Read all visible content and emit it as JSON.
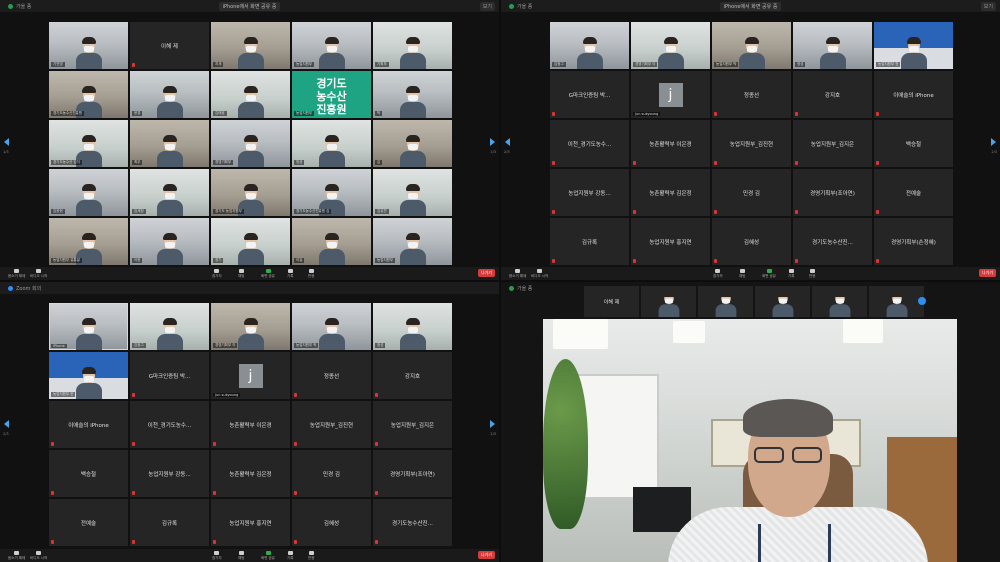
{
  "screen_tl": {
    "title_left": "가을 종",
    "title_center": "iPhone에서 화면 공유 중",
    "title_right": "보기",
    "page_left": "1/3",
    "page_right": "1/3",
    "tiles": [
      {
        "type": "video",
        "label": "기연영"
      },
      {
        "type": "name",
        "name": "이해 제"
      },
      {
        "type": "video",
        "label": "지세"
      },
      {
        "type": "video",
        "label": "농업지원부"
      },
      {
        "type": "video",
        "label": "기획부"
      },
      {
        "type": "video",
        "label": "경기도농수산진흥원"
      },
      {
        "type": "video",
        "label": "윤경"
      },
      {
        "type": "video",
        "label": "김태호"
      },
      {
        "type": "logo",
        "logo_text": "경기도\n농수산\n진흥원",
        "label": "농업지원부"
      },
      {
        "type": "video",
        "label": "박"
      },
      {
        "type": "video",
        "label": "경기도농수산 김이"
      },
      {
        "type": "video",
        "label": "최우"
      },
      {
        "type": "video",
        "label": "경영기획부"
      },
      {
        "type": "video",
        "label": "정성"
      },
      {
        "type": "video",
        "label": "김"
      },
      {
        "type": "video",
        "label": "김윤현"
      },
      {
        "type": "video",
        "label": "임세정"
      },
      {
        "type": "video",
        "label": "경기도 농업지원부"
      },
      {
        "type": "video",
        "label": "경기도농수산진흥원 김"
      },
      {
        "type": "video",
        "label": "김유찬"
      },
      {
        "type": "video",
        "label": "농업지원부 유통발"
      },
      {
        "type": "video",
        "label": "이현"
      },
      {
        "type": "video",
        "label": "경기"
      },
      {
        "type": "video",
        "label": "이유"
      },
      {
        "type": "video",
        "label": "농업지원부"
      }
    ],
    "end_label": "나가기"
  },
  "screen_tr": {
    "title_left": "가을 종",
    "title_center": "iPhone에서 화면 공유 중",
    "title_right": "보기",
    "page_left": "2/3",
    "page_right": "2/3",
    "tiles": [
      {
        "type": "video",
        "label": "김정그"
      },
      {
        "type": "video",
        "label": "경영기획부 이"
      },
      {
        "type": "video",
        "label": "농업지원부 박"
      },
      {
        "type": "video",
        "label": "정성"
      },
      {
        "type": "board",
        "label": "농업지원부 한"
      },
      {
        "type": "name",
        "name": "G마크인증팀 박..."
      },
      {
        "type": "j",
        "letter": "j",
        "label": "jun sukyoung"
      },
      {
        "type": "name",
        "name": "정종선"
      },
      {
        "type": "name",
        "name": "강지호"
      },
      {
        "type": "name",
        "name": "이애슬의 iPhone"
      },
      {
        "type": "name",
        "name": "이천_경기도농수..."
      },
      {
        "type": "name",
        "name": "농촌활력부 이은경"
      },
      {
        "type": "name",
        "name": "농업지원부_김진현"
      },
      {
        "type": "name",
        "name": "농업지원부_김지은"
      },
      {
        "type": "name",
        "name": "백승철"
      },
      {
        "type": "name",
        "name": "농업지원부 강동..."
      },
      {
        "type": "name",
        "name": "농촌활력부 김은정"
      },
      {
        "type": "name",
        "name": "민경 김"
      },
      {
        "type": "name",
        "name": "경영기획부(조아연)"
      },
      {
        "type": "name",
        "name": "전예술"
      },
      {
        "type": "name",
        "name": "김규록"
      },
      {
        "type": "name",
        "name": "농업지원부 홍지연"
      },
      {
        "type": "name",
        "name": "김혜성"
      },
      {
        "type": "name",
        "name": "경기도농수산진..."
      },
      {
        "type": "name",
        "name": "경영기획부(손정혜)"
      }
    ],
    "end_label": "나가기"
  },
  "screen_bl": {
    "title_left": "Zoom 회의",
    "page_left": "2/3",
    "page_right": "2/3",
    "tiles": [
      {
        "type": "video",
        "label": "iPhone"
      },
      {
        "type": "video",
        "label": "김정그"
      },
      {
        "type": "video",
        "label": "경영기획부 이"
      },
      {
        "type": "video",
        "label": "농업지원부 박"
      },
      {
        "type": "video",
        "label": "정성"
      },
      {
        "type": "board",
        "label": "농업지원부 한"
      },
      {
        "type": "name",
        "name": "G마크인증팀 박..."
      },
      {
        "type": "j",
        "letter": "j",
        "label": "jun sukyoung"
      },
      {
        "type": "name",
        "name": "정종선"
      },
      {
        "type": "name",
        "name": "강지호"
      },
      {
        "type": "name",
        "name": "이애슬의 iPhone"
      },
      {
        "type": "name",
        "name": "이천_경기도농수..."
      },
      {
        "type": "name",
        "name": "농촌활력부 이은경"
      },
      {
        "type": "name",
        "name": "농업지원부_김진현"
      },
      {
        "type": "name",
        "name": "농업지원부_김지은"
      },
      {
        "type": "name",
        "name": "백승철"
      },
      {
        "type": "name",
        "name": "농업지원부 강동..."
      },
      {
        "type": "name",
        "name": "농촌활력부 김은정"
      },
      {
        "type": "name",
        "name": "민경 김"
      },
      {
        "type": "name",
        "name": "경영기획부(조아연)"
      },
      {
        "type": "name",
        "name": "전예술"
      },
      {
        "type": "name",
        "name": "김규록"
      },
      {
        "type": "name",
        "name": "농업지원부 홍지연"
      },
      {
        "type": "name",
        "name": "김혜성"
      },
      {
        "type": "name",
        "name": "경기도농수산진..."
      }
    ],
    "end_label": "나가기"
  },
  "screen_br": {
    "title_left": "가을 종",
    "strip": [
      {
        "type": "name",
        "name": "이해 제"
      },
      {
        "type": "video"
      },
      {
        "type": "video"
      },
      {
        "type": "video"
      },
      {
        "type": "video"
      },
      {
        "type": "video"
      }
    ]
  },
  "toolbar": {
    "items": [
      "음소거 해제",
      "비디오 시작",
      "참가자",
      "채팅",
      "화면 공유",
      "기록",
      "반응"
    ]
  },
  "colors": {
    "end_button": "#d43c3c",
    "active_speaker_border": "#f2e64a",
    "accent_arrow": "#4aa3e8"
  }
}
